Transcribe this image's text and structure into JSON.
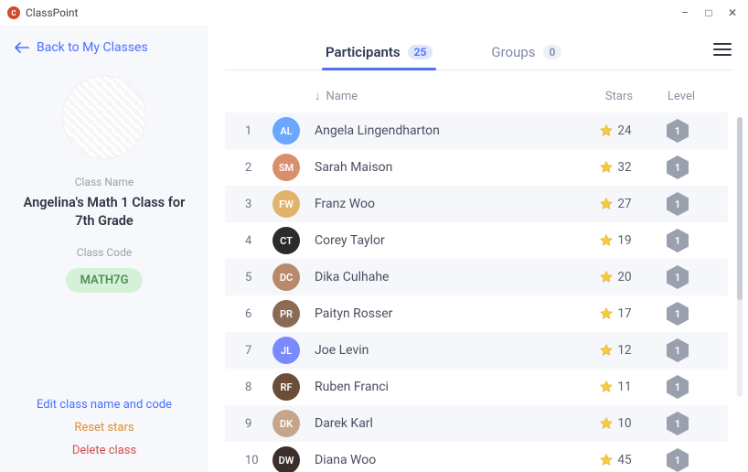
{
  "app": {
    "title": "ClassPoint"
  },
  "windowControls": {
    "minimize": "–",
    "maximize": "□",
    "close": "✕"
  },
  "sidebar": {
    "back_label": "Back to My Classes",
    "class_name_label": "Class Name",
    "class_name": "Angelina's Math 1 Class for 7th Grade",
    "class_code_label": "Class Code",
    "class_code": "MATH7G",
    "edit_label": "Edit class name and code",
    "reset_label": "Reset stars",
    "delete_label": "Delete class"
  },
  "tabs": {
    "participants": {
      "label": "Participants",
      "count": "25"
    },
    "groups": {
      "label": "Groups",
      "count": "0"
    }
  },
  "columns": {
    "name": "Name",
    "stars": "Stars",
    "level": "Level"
  },
  "participants": [
    {
      "rank": "1",
      "name": "Angela Lingendharton",
      "stars": "24",
      "level": "1",
      "avatar_color": "#6aa7ff"
    },
    {
      "rank": "2",
      "name": "Sarah Maison",
      "stars": "32",
      "level": "1",
      "avatar_color": "#d98f6b"
    },
    {
      "rank": "3",
      "name": "Franz Woo",
      "stars": "27",
      "level": "1",
      "avatar_color": "#e2b36b"
    },
    {
      "rank": "4",
      "name": "Corey Taylor",
      "stars": "19",
      "level": "1",
      "avatar_color": "#2b2b2b"
    },
    {
      "rank": "5",
      "name": "Dika Culhahe",
      "stars": "20",
      "level": "1",
      "avatar_color": "#b88a6b"
    },
    {
      "rank": "6",
      "name": "Paityn Rosser",
      "stars": "17",
      "level": "1",
      "avatar_color": "#8a6b54"
    },
    {
      "rank": "7",
      "name": "Joe Levin",
      "stars": "12",
      "level": "1",
      "avatar_color": "#7a8aff"
    },
    {
      "rank": "8",
      "name": "Ruben Franci",
      "stars": "11",
      "level": "1",
      "avatar_color": "#6b4d38"
    },
    {
      "rank": "9",
      "name": "Darek Karl",
      "stars": "10",
      "level": "1",
      "avatar_color": "#c7a58a"
    },
    {
      "rank": "10",
      "name": "Diana Woo",
      "stars": "45",
      "level": "1",
      "avatar_color": "#3a2f2a"
    }
  ]
}
